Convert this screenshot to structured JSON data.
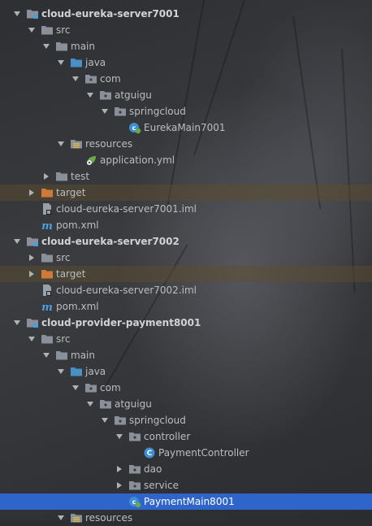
{
  "tree": [
    {
      "label": "cloud-eureka-server7001",
      "depth": 0,
      "arrow": "down",
      "icon": "module-folder-icon",
      "bold": true
    },
    {
      "label": "src",
      "depth": 1,
      "arrow": "down",
      "icon": "folder-icon"
    },
    {
      "label": "main",
      "depth": 2,
      "arrow": "down",
      "icon": "folder-icon"
    },
    {
      "label": "java",
      "depth": 3,
      "arrow": "down",
      "icon": "source-folder-icon"
    },
    {
      "label": "com",
      "depth": 4,
      "arrow": "down",
      "icon": "package-icon"
    },
    {
      "label": "atguigu",
      "depth": 5,
      "arrow": "down",
      "icon": "package-icon"
    },
    {
      "label": "springcloud",
      "depth": 6,
      "arrow": "down",
      "icon": "package-icon"
    },
    {
      "label": "EurekaMain7001",
      "depth": 7,
      "arrow": "none",
      "icon": "spring-boot-class-icon"
    },
    {
      "label": "resources",
      "depth": 3,
      "arrow": "down",
      "icon": "resources-folder-icon"
    },
    {
      "label": "application.yml",
      "depth": 4,
      "arrow": "none",
      "icon": "yaml-config-icon"
    },
    {
      "label": "test",
      "depth": 2,
      "arrow": "right",
      "icon": "folder-icon"
    },
    {
      "label": "target",
      "depth": 1,
      "arrow": "right",
      "icon": "excluded-folder-icon",
      "highlight": true
    },
    {
      "label": "cloud-eureka-server7001.iml",
      "depth": 1,
      "arrow": "none",
      "icon": "iml-file-icon"
    },
    {
      "label": "pom.xml",
      "depth": 1,
      "arrow": "none",
      "icon": "maven-pom-icon"
    },
    {
      "label": "cloud-eureka-server7002",
      "depth": 0,
      "arrow": "down",
      "icon": "module-folder-icon",
      "bold": true
    },
    {
      "label": "src",
      "depth": 1,
      "arrow": "right",
      "icon": "folder-icon"
    },
    {
      "label": "target",
      "depth": 1,
      "arrow": "right",
      "icon": "excluded-folder-icon",
      "highlight": true
    },
    {
      "label": "cloud-eureka-server7002.iml",
      "depth": 1,
      "arrow": "none",
      "icon": "iml-file-icon"
    },
    {
      "label": "pom.xml",
      "depth": 1,
      "arrow": "none",
      "icon": "maven-pom-icon"
    },
    {
      "label": "cloud-provider-payment8001",
      "depth": 0,
      "arrow": "down",
      "icon": "module-folder-icon",
      "bold": true
    },
    {
      "label": "src",
      "depth": 1,
      "arrow": "down",
      "icon": "folder-icon"
    },
    {
      "label": "main",
      "depth": 2,
      "arrow": "down",
      "icon": "folder-icon"
    },
    {
      "label": "java",
      "depth": 3,
      "arrow": "down",
      "icon": "source-folder-icon"
    },
    {
      "label": "com",
      "depth": 4,
      "arrow": "down",
      "icon": "package-icon"
    },
    {
      "label": "atguigu",
      "depth": 5,
      "arrow": "down",
      "icon": "package-icon"
    },
    {
      "label": "springcloud",
      "depth": 6,
      "arrow": "down",
      "icon": "package-icon"
    },
    {
      "label": "controller",
      "depth": 7,
      "arrow": "down",
      "icon": "package-icon"
    },
    {
      "label": "PaymentController",
      "depth": 8,
      "arrow": "none",
      "icon": "java-class-icon"
    },
    {
      "label": "dao",
      "depth": 7,
      "arrow": "right",
      "icon": "package-icon"
    },
    {
      "label": "service",
      "depth": 7,
      "arrow": "right",
      "icon": "package-icon"
    },
    {
      "label": "PaymentMain8001",
      "depth": 7,
      "arrow": "none",
      "icon": "spring-boot-class-icon",
      "selected": true
    },
    {
      "label": "resources",
      "depth": 3,
      "arrow": "down",
      "icon": "resources-folder-icon"
    }
  ],
  "colors": {
    "selection": "#2f65ca",
    "highlight": "#5f4e2a",
    "folder": "#8a9099",
    "source_folder": "#4a90c8",
    "excluded_folder": "#d07a3a",
    "module_marker": "#4a9fd8",
    "spring_green": "#6aaa4a",
    "java_class": "#3c8fd4",
    "maven": "#4d9fe0"
  }
}
